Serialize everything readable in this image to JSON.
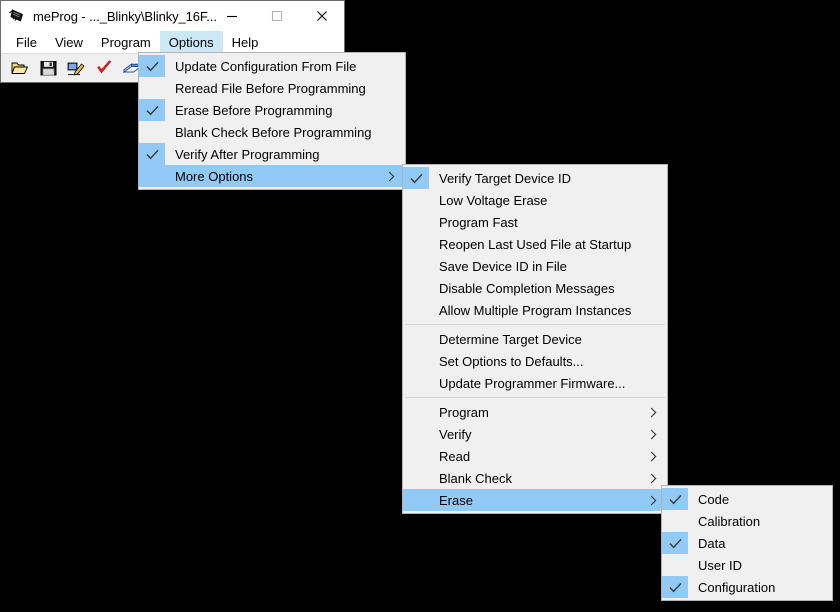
{
  "window": {
    "title": "meProg - ..._Blinky\\Blinky_16F...",
    "icon": "chip-icon",
    "minimize_label": "—",
    "maximize_label": "□",
    "close_label": "×"
  },
  "menubar": {
    "items": [
      {
        "label": "File",
        "active": false
      },
      {
        "label": "View",
        "active": false
      },
      {
        "label": "Program",
        "active": false
      },
      {
        "label": "Options",
        "active": true
      },
      {
        "label": "Help",
        "active": false
      }
    ]
  },
  "toolbar": {
    "buttons": [
      {
        "name": "open-file-icon",
        "title": "Open"
      },
      {
        "name": "save-file-icon",
        "title": "Save"
      },
      {
        "name": "write-device-icon",
        "title": "Write"
      },
      {
        "name": "verify-check-icon",
        "title": "Verify"
      },
      {
        "name": "read-book-icon",
        "title": "Read"
      },
      {
        "name": "blank-check-bulb-icon",
        "title": "Blank Check"
      }
    ]
  },
  "options_menu": {
    "items": [
      {
        "label": "Update Configuration From File",
        "checked": true,
        "highlight": false,
        "submenu": false
      },
      {
        "label": "Reread File Before Programming",
        "checked": false,
        "highlight": false,
        "submenu": false
      },
      {
        "label": "Erase Before Programming",
        "checked": true,
        "highlight": false,
        "submenu": false
      },
      {
        "label": "Blank Check Before Programming",
        "checked": false,
        "highlight": false,
        "submenu": false
      },
      {
        "label": "Verify After Programming",
        "checked": true,
        "highlight": false,
        "submenu": false
      },
      {
        "label": "More Options",
        "checked": false,
        "highlight": true,
        "submenu": true
      }
    ]
  },
  "more_options_menu": {
    "groups": [
      {
        "items": [
          {
            "label": "Verify Target Device ID",
            "checked": true,
            "highlight": false,
            "submenu": false
          },
          {
            "label": "Low Voltage Erase",
            "checked": false,
            "highlight": false,
            "submenu": false
          },
          {
            "label": "Program Fast",
            "checked": false,
            "highlight": false,
            "submenu": false
          },
          {
            "label": "Reopen Last Used File at Startup",
            "checked": false,
            "highlight": false,
            "submenu": false
          },
          {
            "label": "Save Device ID in File",
            "checked": false,
            "highlight": false,
            "submenu": false
          },
          {
            "label": "Disable Completion Messages",
            "checked": false,
            "highlight": false,
            "submenu": false
          },
          {
            "label": "Allow Multiple Program Instances",
            "checked": false,
            "highlight": false,
            "submenu": false
          }
        ]
      },
      {
        "items": [
          {
            "label": "Determine Target Device",
            "checked": false,
            "highlight": false,
            "submenu": false
          },
          {
            "label": "Set Options to Defaults...",
            "checked": false,
            "highlight": false,
            "submenu": false
          },
          {
            "label": "Update Programmer Firmware...",
            "checked": false,
            "highlight": false,
            "submenu": false
          }
        ]
      },
      {
        "items": [
          {
            "label": "Program",
            "checked": false,
            "highlight": false,
            "submenu": true
          },
          {
            "label": "Verify",
            "checked": false,
            "highlight": false,
            "submenu": true
          },
          {
            "label": "Read",
            "checked": false,
            "highlight": false,
            "submenu": true
          },
          {
            "label": "Blank Check",
            "checked": false,
            "highlight": false,
            "submenu": true
          },
          {
            "label": "Erase",
            "checked": false,
            "highlight": true,
            "submenu": true
          }
        ]
      }
    ]
  },
  "erase_menu": {
    "items": [
      {
        "label": "Code",
        "checked": true,
        "highlight": false,
        "submenu": false
      },
      {
        "label": "Calibration",
        "checked": false,
        "highlight": false,
        "submenu": false
      },
      {
        "label": "Data",
        "checked": true,
        "highlight": false,
        "submenu": false
      },
      {
        "label": "User ID",
        "checked": false,
        "highlight": false,
        "submenu": false
      },
      {
        "label": "Configuration",
        "checked": true,
        "highlight": false,
        "submenu": false
      }
    ]
  },
  "colors": {
    "menu_background": "#f0f0f0",
    "highlight": "#91c9f7",
    "menubar_highlight": "#cce8f7",
    "window_background": "#ffffff",
    "toolbar_background": "#f0f0f0",
    "desktop": "#000000",
    "separator": "#d7d7d7",
    "menu_border": "#b4b4b4"
  }
}
